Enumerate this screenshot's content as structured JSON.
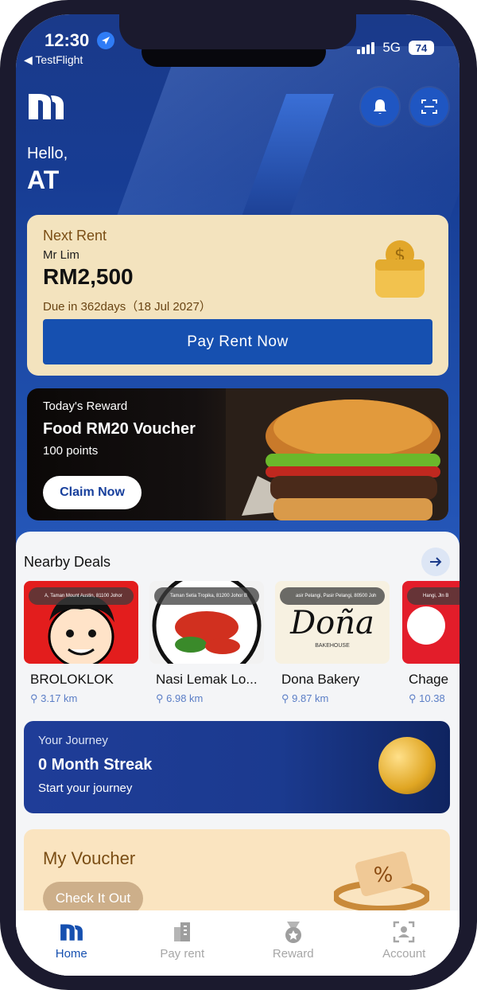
{
  "status_bar": {
    "time": "12:30",
    "back_app": "◀ TestFlight",
    "network": "5G",
    "battery": "74"
  },
  "header": {
    "greeting": "Hello,",
    "user_name": "AT"
  },
  "rent": {
    "label": "Next Rent",
    "landlord": "Mr Lim",
    "amount": "RM2,500",
    "due": "Due in 362days（18 Jul 2027）",
    "pay_button": "Pay Rent Now"
  },
  "reward": {
    "subtitle": "Today's Reward",
    "title": "Food RM20 Voucher",
    "points": "100 points",
    "claim_button": "Claim Now"
  },
  "nearby": {
    "title": "Nearby Deals",
    "deals": [
      {
        "name": "BROLOKLOK",
        "distance": "3.17 km",
        "address": "A, Taman Mount Austin, 81100 Johor",
        "color": "#e31d1d"
      },
      {
        "name": "Nasi Lemak Lo...",
        "distance": "6.98 km",
        "address": "Taman Setia Tropika, 81200 Johor B",
        "color": "#ffffff"
      },
      {
        "name": "Dona Bakery",
        "distance": "9.87 km",
        "address": "asir Pelangi, Pasir Pelangi, 80500 Joh",
        "color": "#f7f1e1",
        "logo_text": "Doña",
        "logo_sub": "BAKEHOUSE"
      },
      {
        "name": "Chage",
        "distance": "10.38",
        "address": "Hangi, Jln B",
        "color": "#e31d2a"
      }
    ]
  },
  "journey": {
    "subtitle": "Your Journey",
    "title": "0 Month Streak",
    "cta": "Start your journey"
  },
  "voucher": {
    "title": "My Voucher",
    "button": "Check It Out"
  },
  "tabs": [
    {
      "label": "Home",
      "icon": "home-logo-icon",
      "active": true
    },
    {
      "label": "Pay rent",
      "icon": "building-icon",
      "active": false
    },
    {
      "label": "Reward",
      "icon": "medal-icon",
      "active": false
    },
    {
      "label": "Account",
      "icon": "account-icon",
      "active": false
    }
  ],
  "colors": {
    "primary": "#1650b0",
    "rent_card": "#f3e3be",
    "voucher_card": "#fae4c0"
  }
}
